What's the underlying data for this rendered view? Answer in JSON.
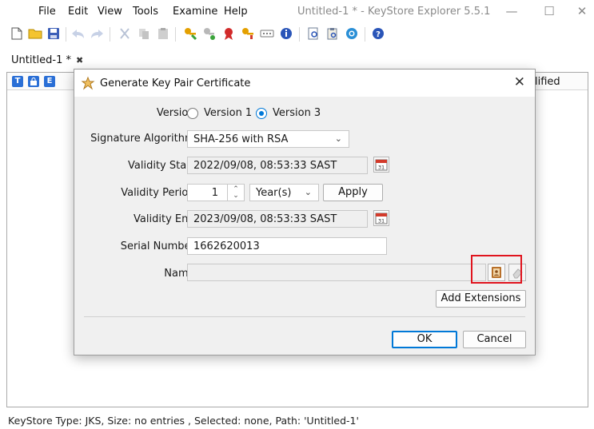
{
  "window": {
    "title": "Untitled-1 * - KeyStore Explorer 5.5.1",
    "menu": [
      "File",
      "Edit",
      "View",
      "Tools",
      "Examine",
      "Help"
    ],
    "controls": {
      "minimize": "—",
      "maximize": "☐",
      "close": "✕"
    }
  },
  "toolbar": {
    "icons": [
      "new-icon",
      "open-icon",
      "save-icon",
      "undo-icon",
      "redo-icon",
      "cut-icon",
      "copy-icon",
      "paste-icon",
      "generate-key-pair-icon",
      "generate-secret-key-icon",
      "import-trusted-certificate-icon",
      "import-key-pair-icon",
      "set-password-icon",
      "properties-icon",
      "examine-file-icon",
      "examine-clipboard-icon",
      "examine-ssl-icon",
      "help-icon"
    ]
  },
  "tab": {
    "label": "Untitled-1 *",
    "close": "✖"
  },
  "table": {
    "header_icons": [
      {
        "name": "type-column-icon",
        "glyph": "T",
        "color": "#2a6fd6"
      },
      {
        "name": "lock-column-icon",
        "glyph": "",
        "color": "#2a6fd6"
      },
      {
        "name": "expiry-column-icon",
        "glyph": "E",
        "color": "#2a6fd6"
      }
    ],
    "visible_column_label": "lified"
  },
  "status_bar": "KeyStore Type: JKS, Size: no entries , Selected: none, Path: 'Untitled-1'",
  "dialog": {
    "title": "Generate Key Pair Certificate",
    "close_glyph": "✕",
    "version": {
      "label": "Version:",
      "option1": "Version 1",
      "option2": "Version 3",
      "selected": "Version 3"
    },
    "signature_algorithm": {
      "label": "Signature Algorithm:",
      "value": "SHA-256 with RSA"
    },
    "validity_start": {
      "label": "Validity Start:",
      "value": "2022/09/08, 08:53:33 SAST"
    },
    "validity_period": {
      "label": "Validity Period:",
      "amount": "1",
      "unit": "Year(s)",
      "apply": "Apply"
    },
    "validity_end": {
      "label": "Validity End:",
      "value": "2023/09/08, 08:53:33 SAST"
    },
    "serial_number": {
      "label": "Serial Number:",
      "value": "1662620013"
    },
    "name": {
      "label": "Name:",
      "value": ""
    },
    "add_extensions": "Add Extensions",
    "ok": "OK",
    "cancel": "Cancel"
  },
  "colors": {
    "accent": "#0078d7",
    "highlight": "#e0141e",
    "dialog_bg": "#f0f0f0"
  }
}
